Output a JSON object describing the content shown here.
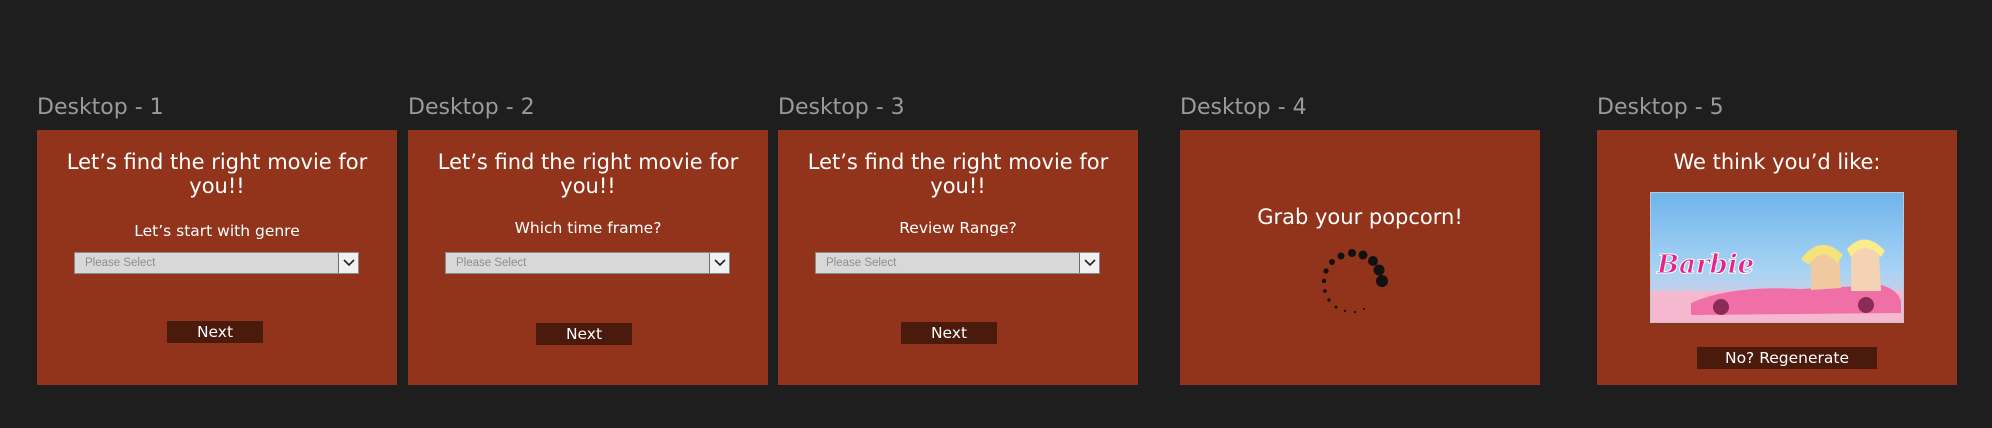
{
  "frames": [
    {
      "label": "Desktop - 1",
      "headline": "Let’s find the right movie for you!!",
      "question": "Let’s start with genre",
      "select_placeholder": "Please Select",
      "button": "Next"
    },
    {
      "label": "Desktop - 2",
      "headline": "Let’s find the right movie for you!!",
      "question": "Which time frame?",
      "select_placeholder": "Please Select",
      "button": "Next"
    },
    {
      "label": "Desktop - 3",
      "headline": "Let’s find the right movie for you!!",
      "question": "Review Range?",
      "select_placeholder": "Please Select",
      "button": "Next"
    },
    {
      "label": "Desktop - 4",
      "headline": "Grab your popcorn!"
    },
    {
      "label": "Desktop - 5",
      "headline": "We think you’d like:",
      "poster_title": "Barbie",
      "button": "No? Regenerate"
    }
  ],
  "colors": {
    "canvas": "#1e1e1e",
    "frame": "#92341b",
    "button": "#4a1a0c",
    "label": "#9a9a9a"
  },
  "icons": [
    "chevron-down-icon",
    "loading-spinner-icon"
  ]
}
